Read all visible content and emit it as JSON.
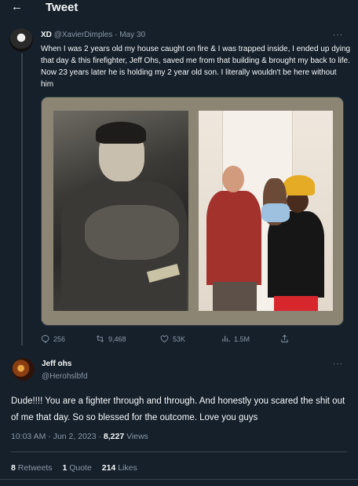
{
  "header": {
    "back_icon": "arrow-left-icon",
    "title": "Tweet"
  },
  "tweet1": {
    "author_name": "XD",
    "handle": "@XavierDimples",
    "separator": "·",
    "date": "May 30",
    "text": "When I was 2 years old my house caught on fire & I was trapped inside, I ended up dying that day & this firefighter, Jeff Ohs, saved me from that building & brought my back to life. Now 23 years later he is holding my 2 year old son. I literally wouldn't be here without him",
    "more_label": "···",
    "actions": {
      "replies": "256",
      "retweets": "9,468",
      "likes": "53K",
      "views": "1.5M"
    }
  },
  "tweet2": {
    "author_name": "Jeff ohs",
    "handle": "@Herohslbfd",
    "more_label": "···",
    "text": "Dude!!!!  You are a fighter through and through. And honestly you scared the shit out of me that day. So so blessed for the outcome. Love you guys",
    "time": "10:03 AM · Jun 2, 2023 · ",
    "views_count": "8,227",
    "views_label": " Views",
    "stats": {
      "retweets_count": "8",
      "retweets_label": " Retweets",
      "quotes_count": "1",
      "quotes_label": " Quote",
      "likes_count": "214",
      "likes_label": " Likes"
    }
  },
  "colors": {
    "background": "#15202b",
    "text": "#f7f9f9",
    "muted": "#8b98a5",
    "divider": "#38444d"
  }
}
